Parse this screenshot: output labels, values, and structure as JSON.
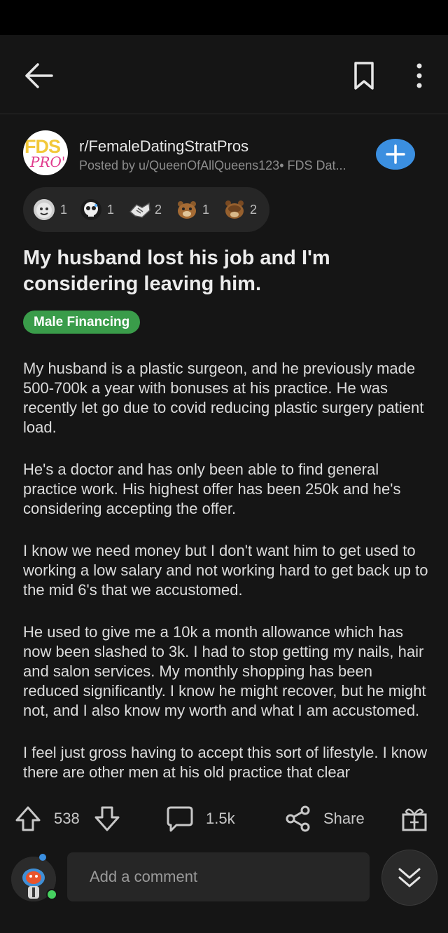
{
  "subreddit": {
    "name": "r/FemaleDatingStratPros",
    "meta": "Posted by u/QueenOfAllQueens123• FDS Dat...",
    "avatar_line1": "FDS",
    "avatar_line2": "PRO'S"
  },
  "awards": [
    {
      "icon": "award-face-icon",
      "count": "1"
    },
    {
      "icon": "award-skull-icon",
      "count": "1"
    },
    {
      "icon": "award-handshake-icon",
      "count": "2"
    },
    {
      "icon": "award-bear-icon",
      "count": "1"
    },
    {
      "icon": "award-bear-facepalm-icon",
      "count": "2"
    }
  ],
  "post": {
    "title": "My husband lost his job and I'm considering leaving him.",
    "flair": "Male Financing",
    "paragraphs": [
      "My husband is a plastic surgeon, and he previously made 500-700k a year with bonuses at his practice. He was recently let go due to covid reducing plastic surgery patient load.",
      "He's a doctor and has only been able to find general practice work. His highest offer has been 250k and he's considering accepting the offer.",
      "I know we need money but I don't want him to get used to working a low salary and not working hard to get back up to the mid 6's that we accustomed.",
      "He used to give me a 10k a month allowance which has now been slashed to 3k. I had to stop getting my nails, hair and salon services. My monthly shopping has been reduced significantly. I know he might recover, but he might not, and I also know my worth and what I am accustomed.",
      "I feel just gross having to accept this sort of lifestyle. I know there are other men at his old practice that clear"
    ]
  },
  "actions": {
    "upvotes": "538",
    "comments": "1.5k",
    "share": "Share"
  },
  "comment": {
    "placeholder": "Add a comment"
  },
  "colors": {
    "background": "#151515",
    "accent_blue": "#3b8fe0",
    "flair_green": "#3a9c4a"
  }
}
